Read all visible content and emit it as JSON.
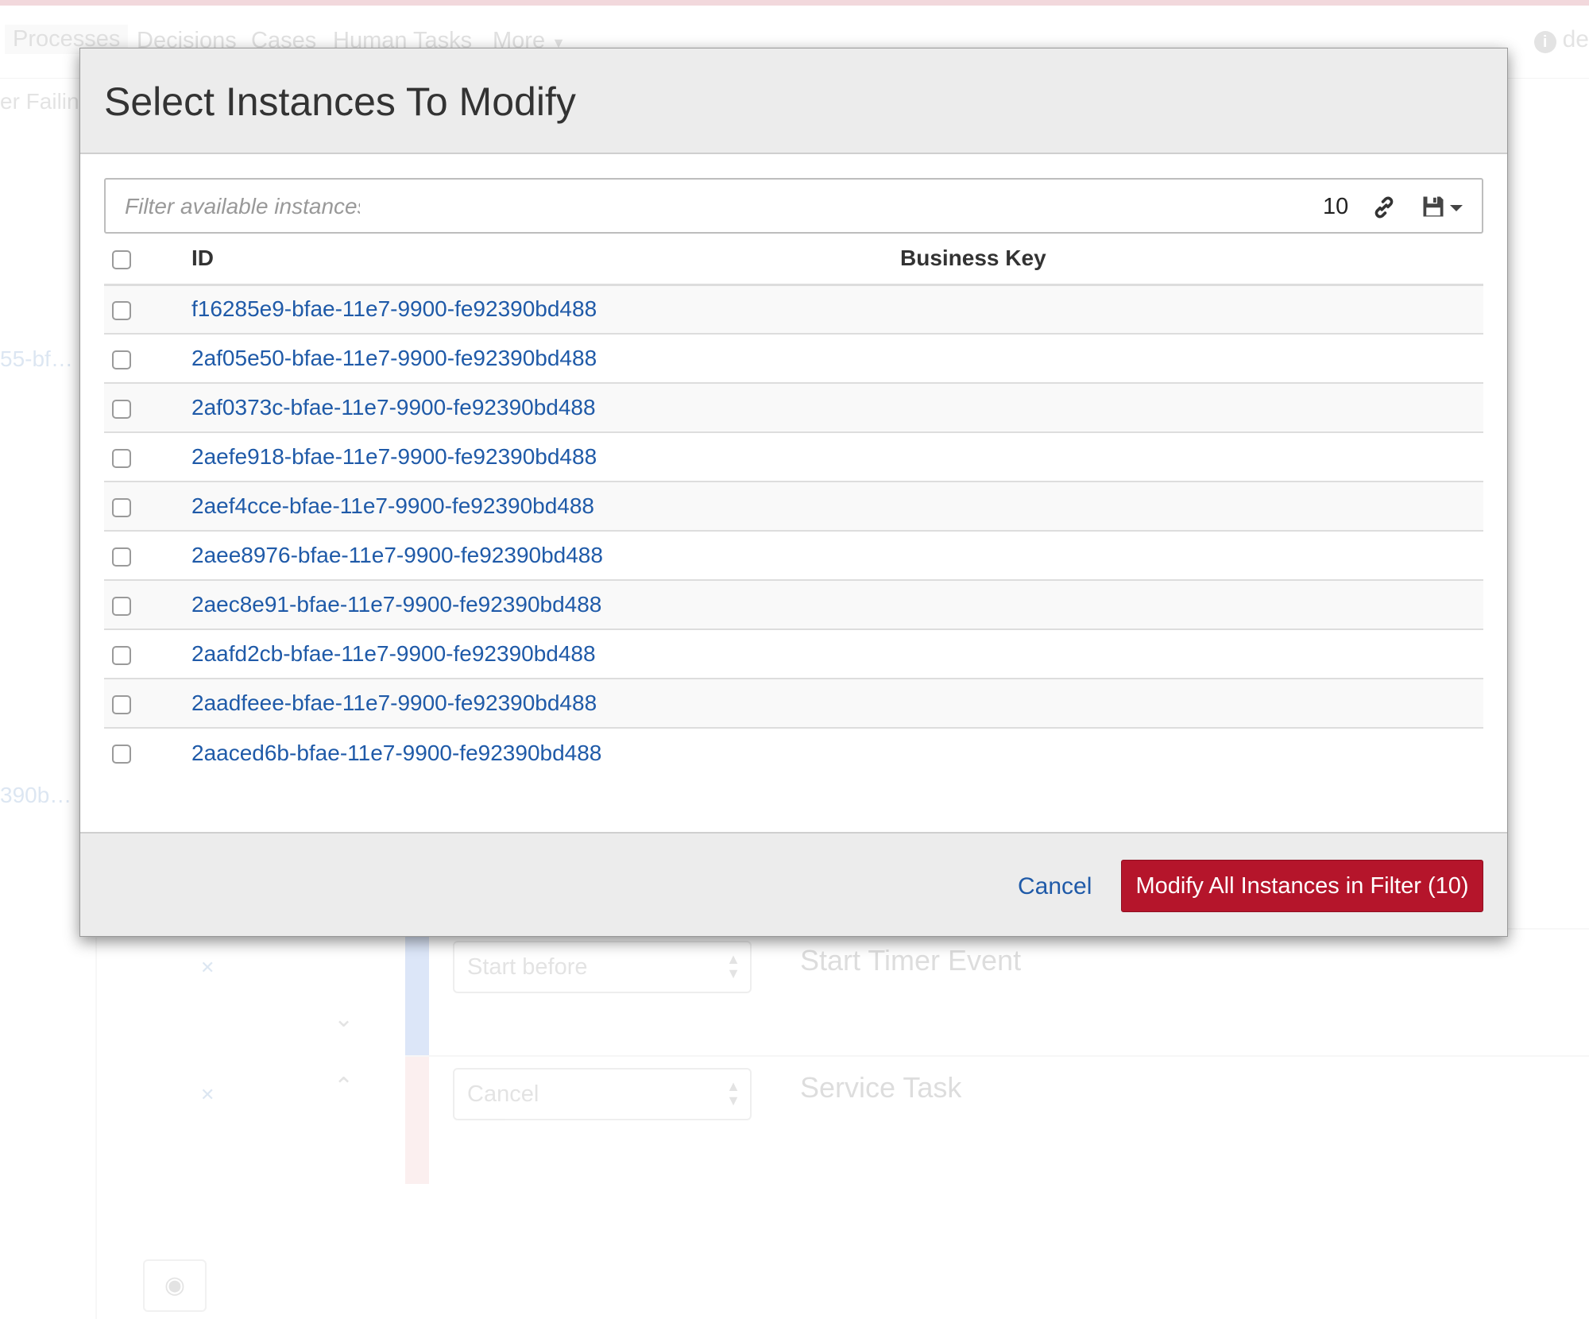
{
  "background": {
    "nav": {
      "items": [
        "Processes",
        "Decisions",
        "Cases",
        "Human Tasks",
        "More"
      ],
      "user": "de"
    },
    "breadcrumb": "er Failin",
    "fragments": [
      "55-bf…",
      "390b…"
    ],
    "rows": [
      {
        "select": "Start before",
        "label": "Start Timer Event",
        "bar_color": "#2b6cd8"
      },
      {
        "select": "Cancel",
        "label": "Service Task",
        "bar_color": "#e8a0a0"
      }
    ]
  },
  "modal": {
    "title": "Select Instances To Modify",
    "filter": {
      "placeholder": "Filter available instances",
      "value": "",
      "count": "10"
    },
    "icons": {
      "link": "link-icon",
      "save": "save-icon",
      "dropdown": "caret-down-icon"
    },
    "table": {
      "headers": {
        "id": "ID",
        "business_key": "Business Key"
      },
      "rows": [
        {
          "id": "f16285e9-bfae-11e7-9900-fe92390bd488",
          "business_key": ""
        },
        {
          "id": "2af05e50-bfae-11e7-9900-fe92390bd488",
          "business_key": ""
        },
        {
          "id": "2af0373c-bfae-11e7-9900-fe92390bd488",
          "business_key": ""
        },
        {
          "id": "2aefe918-bfae-11e7-9900-fe92390bd488",
          "business_key": ""
        },
        {
          "id": "2aef4cce-bfae-11e7-9900-fe92390bd488",
          "business_key": ""
        },
        {
          "id": "2aee8976-bfae-11e7-9900-fe92390bd488",
          "business_key": ""
        },
        {
          "id": "2aec8e91-bfae-11e7-9900-fe92390bd488",
          "business_key": ""
        },
        {
          "id": "2aafd2cb-bfae-11e7-9900-fe92390bd488",
          "business_key": ""
        },
        {
          "id": "2aadfeee-bfae-11e7-9900-fe92390bd488",
          "business_key": ""
        },
        {
          "id": "2aaced6b-bfae-11e7-9900-fe92390bd488",
          "business_key": ""
        }
      ]
    },
    "footer": {
      "cancel_label": "Cancel",
      "modify_label": "Modify All Instances in Filter (10)"
    }
  },
  "colors": {
    "accent": "#b5152b",
    "link": "#1f5aa8",
    "header_bg": "#ececec"
  }
}
